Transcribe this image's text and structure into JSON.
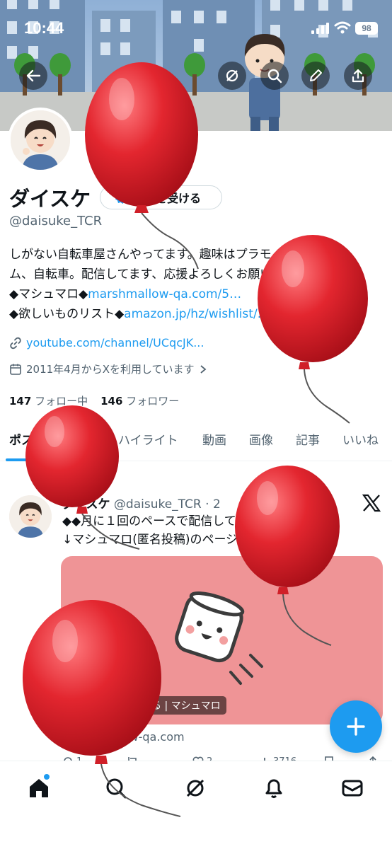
{
  "status_bar": {
    "time": "10:44",
    "battery": "98"
  },
  "header_actions": {
    "back": "back-arrow-icon",
    "grok": "grok-icon",
    "search": "search-icon",
    "edit": "pencil-icon",
    "share": "share-icon"
  },
  "profile": {
    "display_name": "ダイスケ",
    "verify_label": "認証を受ける",
    "handle": "@daisuke_TCR",
    "bio": [
      {
        "text": "しがない自転車屋さんやってます。趣味はプラモ・ガンダ"
      },
      {
        "text": "ム、自転車。配信してます、応援よろしくお願いします。"
      },
      {
        "text": "◆マシュマロ◆",
        "link": "marshmallow-qa.com/5…"
      },
      {
        "text": "◆欲しいものリスト◆",
        "link": "amazon.jp/hz/wishlist/…"
      }
    ],
    "url": "youtube.com/channel/UCqcJK...",
    "joined": "2011年4月からXを利用しています",
    "following_count": "147",
    "following_label": "フォロー中",
    "followers_count": "146",
    "followers_label": "フォロワー"
  },
  "tabs": [
    "ポスト",
    "返信",
    "ハイライト",
    "動画",
    "画像",
    "記事",
    "いいね"
  ],
  "post": {
    "author": "ダイスケ",
    "handle_time": "@daisuke_TCR · 2",
    "lines": [
      "◆◆月に１回のペースで配信しています◆◆",
      "↓マシュマロ(匿名投稿)のページです↓"
    ],
    "card_caption": "マシュマロを投げる | マシュマロ",
    "card_domain": "marshmallow-qa.com",
    "actions": {
      "replies": "1",
      "likes": "2",
      "views": "3716"
    }
  },
  "colors": {
    "accent": "#1d9bf0",
    "card": "#ef9496",
    "balloon": "#e3262f"
  },
  "bottom_nav": [
    "home-icon",
    "search-icon",
    "grok-icon",
    "bell-icon",
    "mail-icon"
  ]
}
